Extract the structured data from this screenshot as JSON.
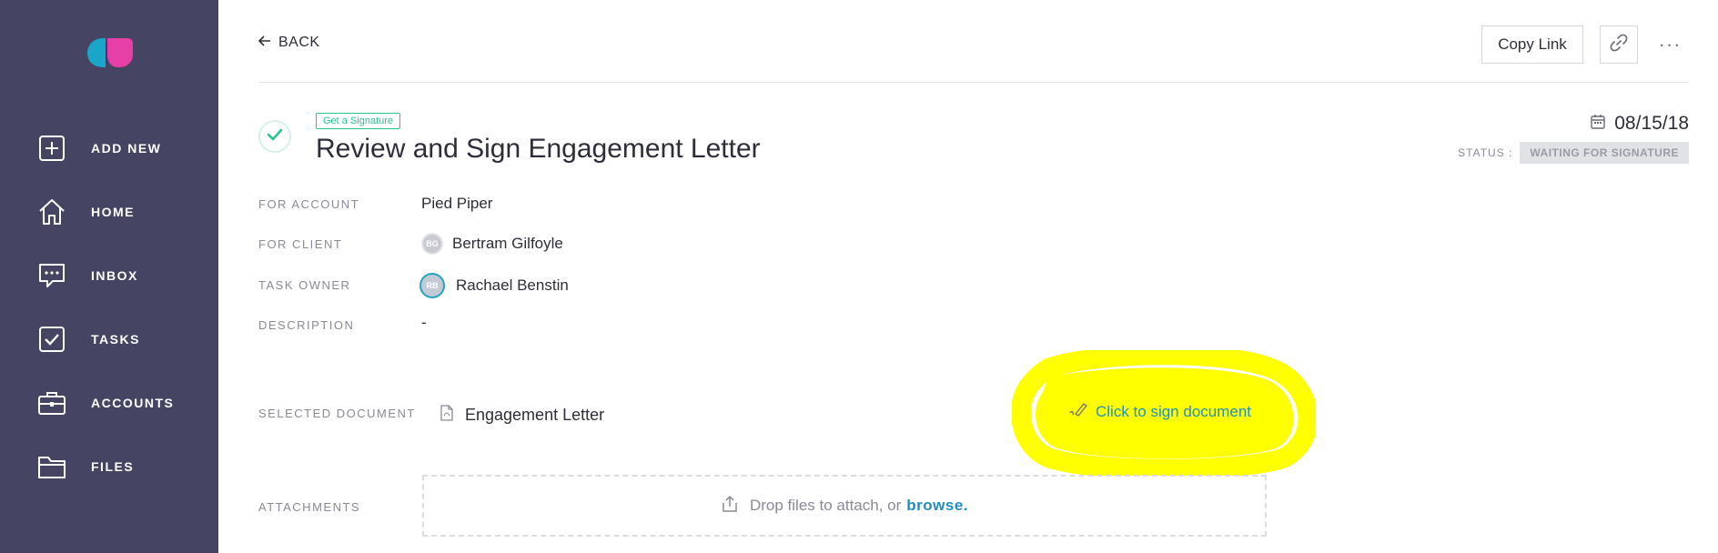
{
  "sidebar": {
    "items": [
      {
        "label": "ADD NEW",
        "icon": "plus-square-icon"
      },
      {
        "label": "HOME",
        "icon": "home-icon"
      },
      {
        "label": "INBOX",
        "icon": "chat-icon"
      },
      {
        "label": "TASKS",
        "icon": "checkbox-icon"
      },
      {
        "label": "ACCOUNTS",
        "icon": "briefcase-icon"
      },
      {
        "label": "FILES",
        "icon": "folder-icon"
      }
    ]
  },
  "header": {
    "back_label": "BACK",
    "copy_link_label": "Copy Link",
    "more_label": "···"
  },
  "task": {
    "tag": "Get a Signature",
    "title": "Review and Sign Engagement Letter",
    "date": "08/15/18",
    "status_label": "STATUS :",
    "status": "WAITING FOR SIGNATURE"
  },
  "fields": {
    "account_label": "FOR ACCOUNT",
    "account_value": "Pied Piper",
    "client_label": "FOR CLIENT",
    "client_initials": "BG",
    "client_value": "Bertram Gilfoyle",
    "owner_label": "TASK OWNER",
    "owner_initials": "RB",
    "owner_value": "Rachael Benstin",
    "description_label": "DESCRIPTION",
    "description_value": "-"
  },
  "document": {
    "label": "SELECTED DOCUMENT",
    "name": "Engagement Letter",
    "sign_label": "Click to sign document"
  },
  "attachments": {
    "label": "ATTACHMENTS",
    "drop_text": "Drop files to attach, or",
    "browse_label": "browse."
  },
  "colors": {
    "sidebar_bg": "#454463",
    "accent_green": "#2cc28f",
    "link_blue": "#1f8fc0",
    "highlight_yellow": "#ffff00"
  }
}
